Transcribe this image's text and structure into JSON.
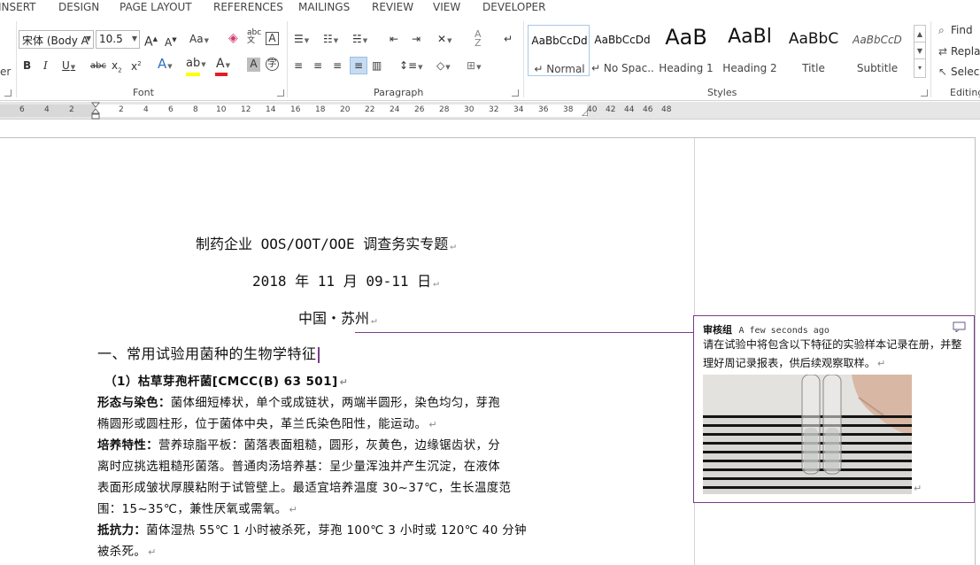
{
  "tabs": [
    "INSERT",
    "DESIGN",
    "PAGE LAYOUT",
    "REFERENCES",
    "MAILINGS",
    "REVIEW",
    "VIEW",
    "DEVELOPER"
  ],
  "font": {
    "name": "宋体 (Body A",
    "size": "10.5",
    "group_label": "Font"
  },
  "paragraph": {
    "group_label": "Paragraph"
  },
  "styles": {
    "group_label": "Styles",
    "items": [
      {
        "preview": "AaBbCcDd",
        "name": "↵ Normal"
      },
      {
        "preview": "AaBbCcDd",
        "name": "↵ No Spac..."
      },
      {
        "preview": "AaB",
        "name": "Heading 1"
      },
      {
        "preview": "AaBl",
        "name": "Heading 2"
      },
      {
        "preview": "AaBbC",
        "name": "Title"
      },
      {
        "preview": "AaBbCcD",
        "name": "Subtitle"
      }
    ]
  },
  "editing": {
    "group_label": "Editing",
    "find": "Find",
    "replace": "Repla",
    "select": "Selec"
  },
  "ruler": {
    "left_ticks": [
      "6",
      "4",
      "2"
    ],
    "right_ticks": [
      "2",
      "4",
      "6",
      "8",
      "10",
      "12",
      "14",
      "16",
      "18",
      "20",
      "22",
      "24",
      "26",
      "28",
      "30",
      "32",
      "34",
      "36",
      "38",
      "40",
      "42",
      "44",
      "46",
      "48"
    ]
  },
  "document": {
    "title": "制药企业 OOS/OOT/OOE 调查务实专题",
    "date": "2018 年 11 月 09-11 日",
    "place": "中国・苏州",
    "heading": "一、常用试验用菌种的生物学特征",
    "subheading": "（1）枯草芽孢杆菌[CMCC(B) 63 501]",
    "paragraphs": [
      {
        "label": "形态与染色：",
        "text": "菌体细短棒状，单个或成链状，两端半圆形，染色均匀，芽孢"
      },
      {
        "label": "",
        "text": "椭圆形或圆柱形，位于菌体中央，革兰氏染色阳性，能运动。"
      },
      {
        "label": "培养特性：",
        "text": "营养琼脂平板：菌落表面粗糙，圆形，灰黄色，边缘锯齿状，分"
      },
      {
        "label": "",
        "text": "离时应挑选粗糙形菌落。普通肉汤培养基：呈少量浑浊并产生沉淀，在液体"
      },
      {
        "label": "",
        "text": "表面形成皱状厚膜粘附于试管壁上。最适宜培养温度 30~37℃，生长温度范"
      },
      {
        "label": "",
        "text": "围：15~35℃，兼性厌氧或需氧。"
      },
      {
        "label": "抵抗力：",
        "text": "菌体湿热 55℃ 1 小时被杀死，芽孢 100℃ 3 小时或 120℃ 40 分钟"
      },
      {
        "label": "",
        "text": "被杀死。"
      }
    ]
  },
  "comment": {
    "author": "审核组",
    "time": "A few seconds ago",
    "text": "请在试验中将包含以下特征的实验样本记录在册，并整理好周记录报表，供后续观察取样。"
  },
  "colors": {
    "comment_border": "#7a3b8a",
    "highlight": "#ffff00",
    "font_color": "#e02020"
  }
}
